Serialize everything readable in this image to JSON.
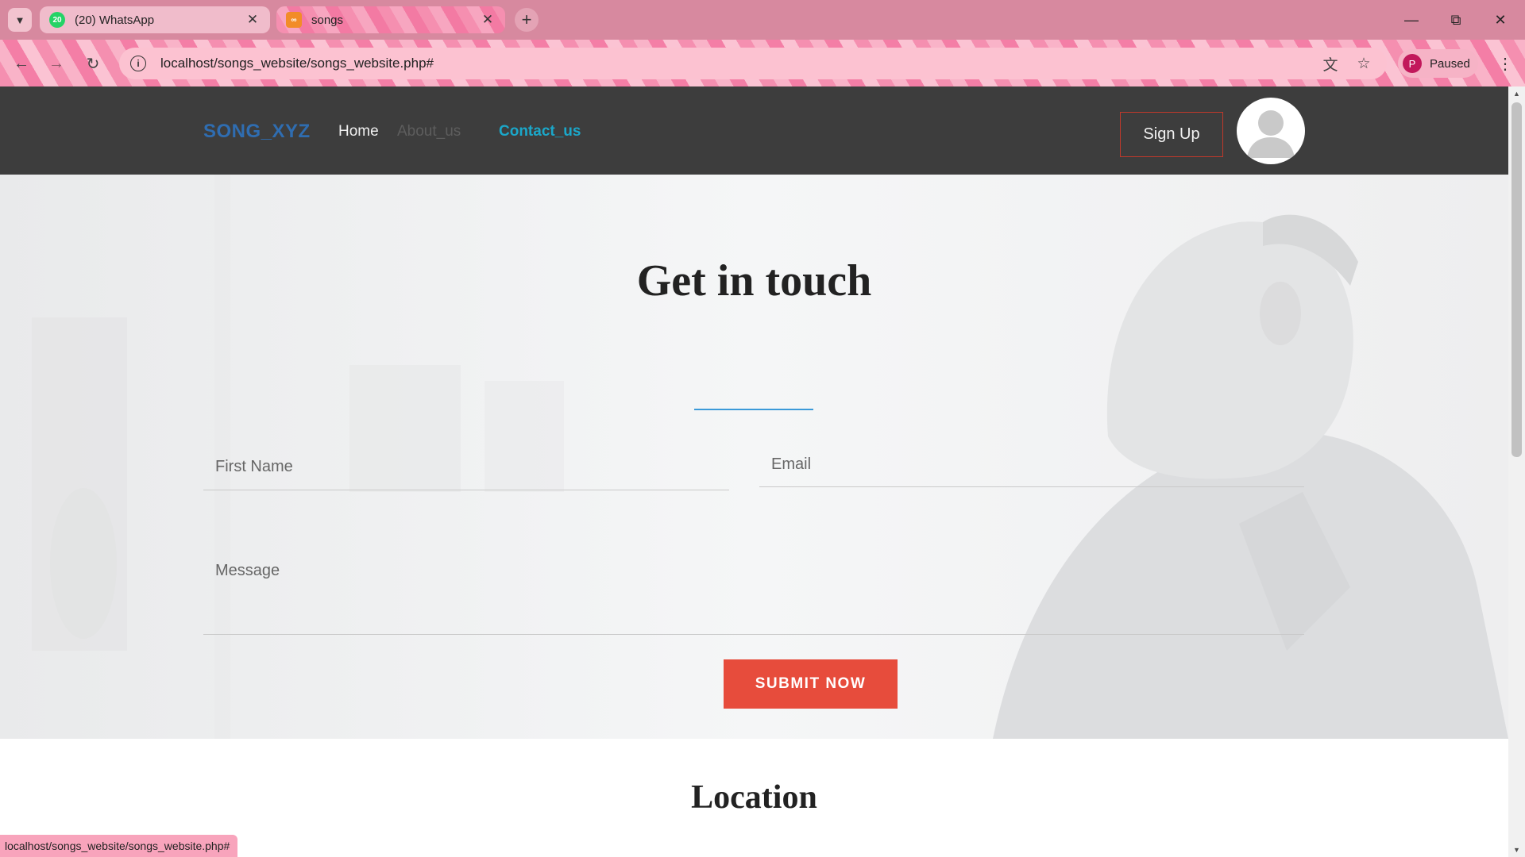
{
  "browser": {
    "tabs": [
      {
        "title": "(20) WhatsApp",
        "badge": "20",
        "icon": "whatsapp-icon"
      },
      {
        "title": "songs",
        "icon": "xampp-icon"
      }
    ],
    "url": "localhost/songs_website/songs_website.php#",
    "profile_initial": "P",
    "profile_status": "Paused",
    "status_url": "localhost/songs_website/songs_website.php#",
    "accent_color": "#d7899f"
  },
  "site": {
    "brand": "SONG_XYZ",
    "nav": {
      "home": "Home",
      "about": "About_us",
      "contact": "Contact_us"
    },
    "signup": "Sign Up"
  },
  "contact": {
    "title": "Get in touch",
    "first_name_placeholder": "First Name",
    "email_placeholder": "Email",
    "message_placeholder": "Message",
    "submit": "SUBMIT NOW",
    "submit_color": "#e74c3c"
  },
  "location": {
    "title": "Location"
  }
}
